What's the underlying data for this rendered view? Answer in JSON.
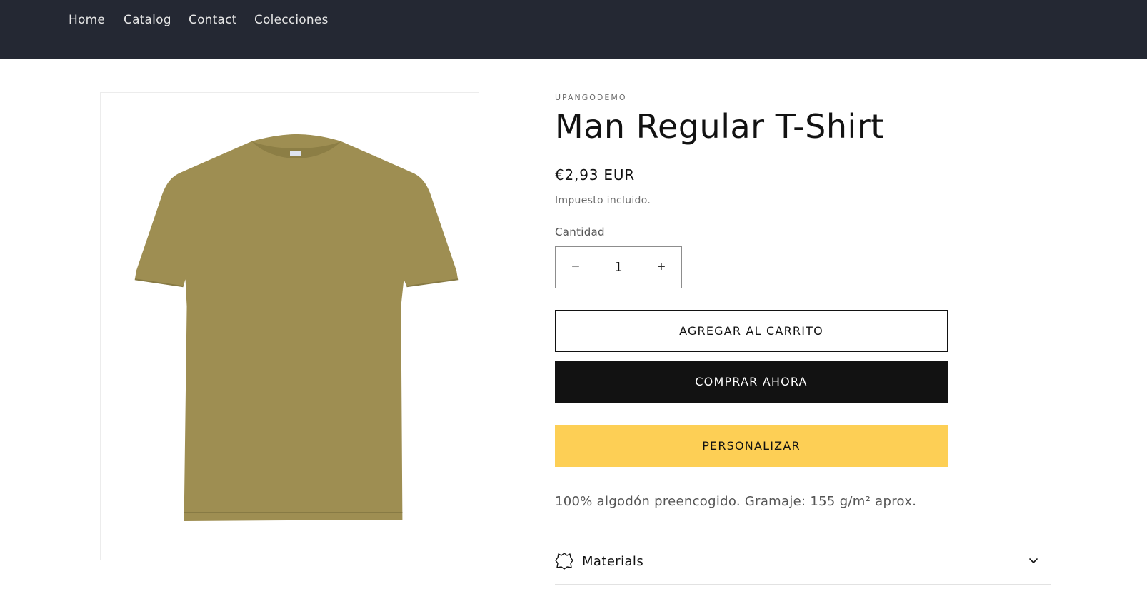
{
  "nav": {
    "items": [
      {
        "label": "Home"
      },
      {
        "label": "Catalog"
      },
      {
        "label": "Contact"
      },
      {
        "label": "Colecciones"
      }
    ]
  },
  "product": {
    "image_icon": "tshirt-image",
    "image_color": "#9e8e52",
    "vendor": "UPANGODEMO",
    "title": "Man Regular T-Shirt",
    "price": "€2,93 EUR",
    "tax_note": "Impuesto incluido.",
    "quantity_label": "Cantidad",
    "quantity_value": "1",
    "minus_symbol": "−",
    "plus_symbol": "+",
    "add_to_cart_label": "AGREGAR AL CARRITO",
    "buy_now_label": "COMPRAR AHORA",
    "personalize_label": "PERSONALIZAR",
    "personalize_color": "#fdcf55",
    "description": "100% algodón preencogido. Gramaje: 155 g/m² aprox.",
    "accordion": {
      "label": "Materials",
      "icon": "leather-icon",
      "chevron": "chevron-down-icon"
    }
  },
  "colors": {
    "header_bg": "#242833",
    "buy_button_bg": "#121212"
  }
}
